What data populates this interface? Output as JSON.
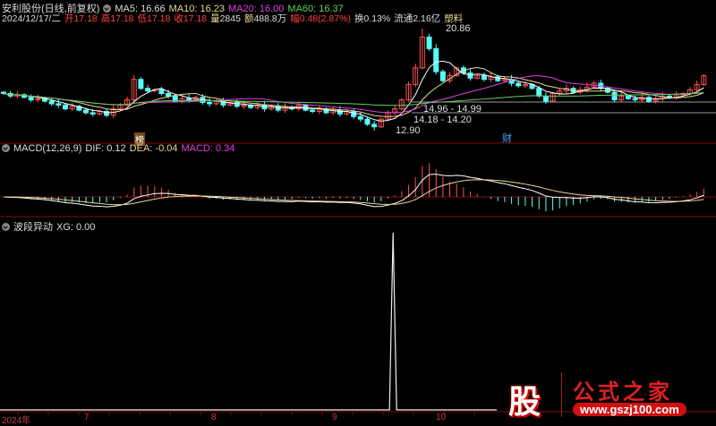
{
  "header": {
    "stock_name": "安利股份(日线,前复权)",
    "ma5": "MA5: 16.66",
    "ma10": "MA10: 16.23",
    "ma20": "MA20: 16.00",
    "ma60": "MA60: 16.37",
    "date": "2024/12/17/二",
    "open_label": "开",
    "open": "17.18",
    "high_label": "高",
    "high": "17.18",
    "low_label": "低",
    "low": "17.18",
    "close_label": "收",
    "close": "17.18",
    "vol_label": "量",
    "vol": "2845",
    "amt_label": "额",
    "amt": "488.8万",
    "chg_label": "幅",
    "chg": "0.48(2.87%)",
    "turnover": "换0.13%",
    "float": "流通2.16亿",
    "industry": "塑料"
  },
  "annotations": {
    "high": "20.86",
    "low": "12.90",
    "range1": "14.96 - 14.99",
    "range2": "14.18 - 14.20",
    "marker1": "榜",
    "marker2": "财"
  },
  "macd": {
    "title": "MACD(12,26,9)",
    "dif": "DIF: 0.12",
    "dea": "DEA: -0.04",
    "macd": "MACD: 0.34"
  },
  "xg": {
    "title": "波段异动",
    "value": "XG: 0.00"
  },
  "axis": {
    "year": "2024年",
    "months": [
      "7",
      "8",
      "9",
      "10"
    ]
  },
  "watermark": {
    "icon_text": "股",
    "title": "公式之家",
    "url": "www.gszj100.com"
  },
  "colors": {
    "up": "#ff5050",
    "down": "#54ffff",
    "ma5": "#ffffff",
    "ma10": "#e8d890",
    "ma20": "#e040e0",
    "ma60": "#60d060",
    "frame": "#7a1010"
  },
  "chart_data": {
    "type": "candlestick",
    "closes": [
      15.8,
      15.6,
      15.7,
      15.5,
      15.3,
      15.4,
      15.2,
      15.0,
      14.9,
      14.6,
      14.8,
      14.5,
      14.3,
      14.2,
      14.4,
      14.1,
      14.6,
      14.9,
      15.3,
      16.9,
      16.2,
      16.0,
      16.1,
      15.8,
      15.6,
      15.2,
      15.4,
      15.3,
      15.5,
      15.1,
      15.0,
      15.2,
      14.9,
      15.1,
      14.8,
      14.9,
      14.7,
      14.9,
      14.6,
      14.8,
      14.5,
      14.7,
      14.6,
      14.9,
      14.5,
      14.4,
      14.6,
      14.3,
      14.5,
      14.2,
      14.4,
      14.0,
      13.8,
      13.4,
      13.2,
      13.8,
      14.3,
      14.6,
      15.3,
      16.5,
      17.8,
      20.2,
      19.3,
      17.5,
      16.8,
      17.2,
      17.8,
      17.4,
      17.0,
      17.2,
      16.9,
      17.1,
      16.8,
      16.9,
      16.6,
      16.4,
      16.5,
      16.2,
      15.6,
      15.2,
      15.8,
      16.0,
      16.2,
      15.9,
      16.1,
      16.3,
      16.6,
      16.2,
      15.9,
      15.3,
      15.6,
      15.4,
      15.3,
      15.5,
      15.2,
      15.4,
      15.6,
      15.5,
      15.7,
      15.8,
      16.1,
      16.5,
      17.18
    ],
    "xg_spike_index": 57
  }
}
